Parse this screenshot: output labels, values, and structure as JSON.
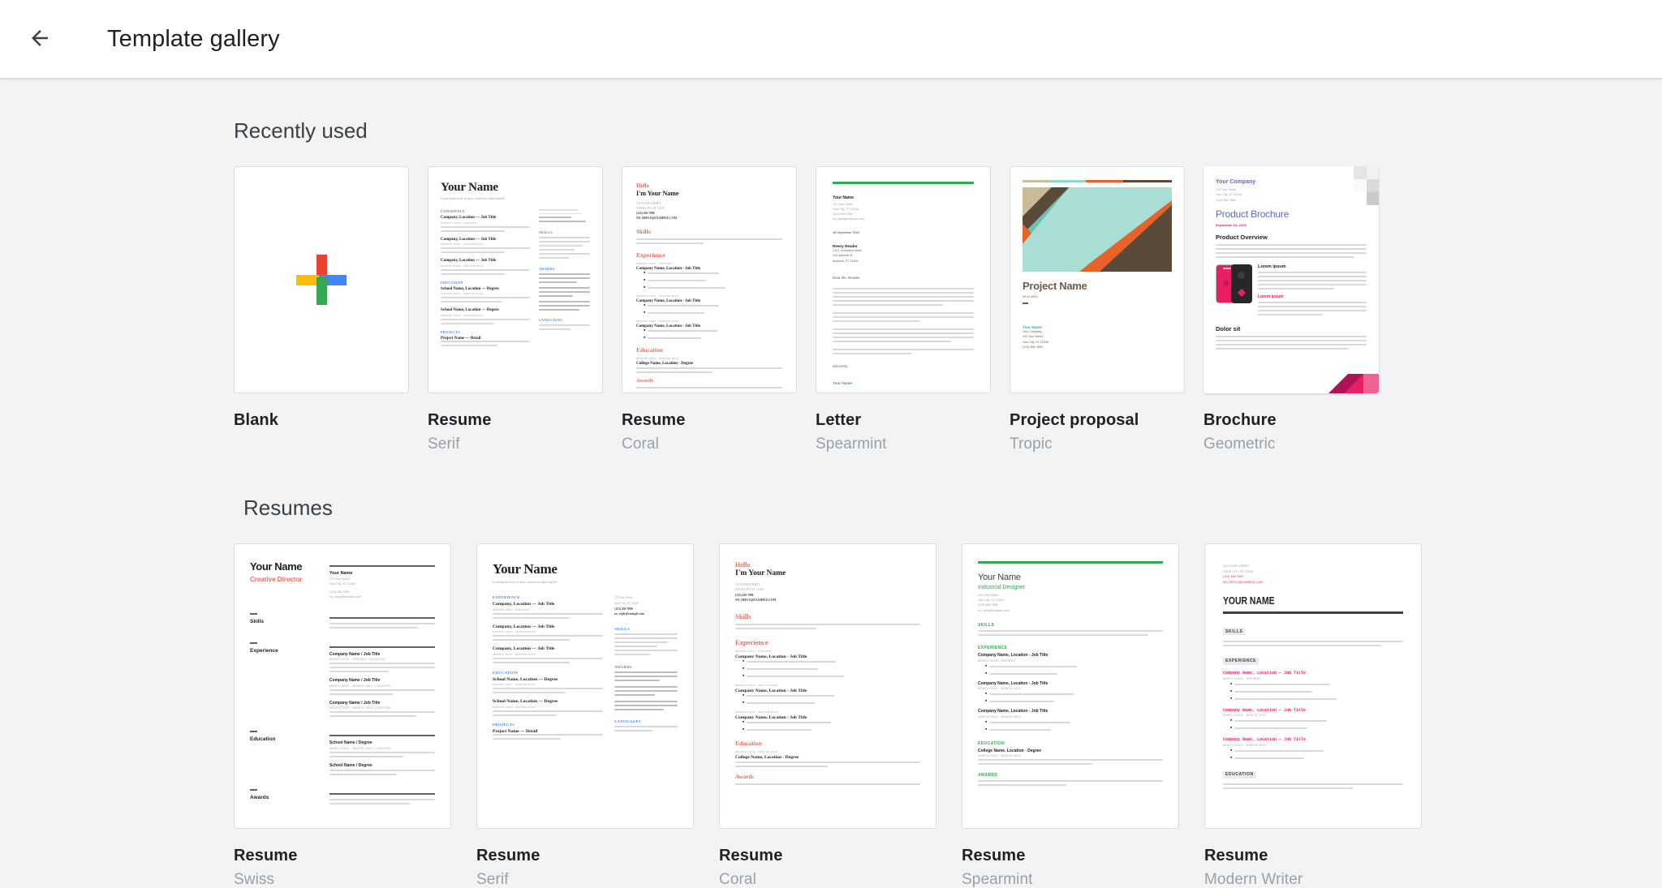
{
  "header": {
    "back_icon": "arrow-left-icon",
    "title": "Template gallery"
  },
  "sections": [
    {
      "id": "recently-used",
      "title": "Recently used",
      "templates": [
        {
          "name": "Blank",
          "sub": ""
        },
        {
          "name": "Resume",
          "sub": "Serif"
        },
        {
          "name": "Resume",
          "sub": "Coral"
        },
        {
          "name": "Letter",
          "sub": "Spearmint"
        },
        {
          "name": "Project proposal",
          "sub": "Tropic"
        },
        {
          "name": "Brochure",
          "sub": "Geometric"
        }
      ]
    },
    {
      "id": "resumes",
      "title": "Resumes",
      "templates": [
        {
          "name": "Resume",
          "sub": "Swiss"
        },
        {
          "name": "Resume",
          "sub": "Serif"
        },
        {
          "name": "Resume",
          "sub": "Coral"
        },
        {
          "name": "Resume",
          "sub": "Spearmint"
        },
        {
          "name": "Resume",
          "sub": "Modern Writer"
        }
      ]
    }
  ],
  "thumb_text": {
    "your_name": "Your Name",
    "hello": "Hello",
    "im_your_name": "I'm Your Name",
    "creative_director": "Creative Director",
    "industrial_designer": "Industrial Designer",
    "your_name_caps": "YOUR NAME",
    "your_company": "Your Company",
    "product_brochure": "Product Brochure",
    "product_overview": "Product Overview",
    "project_name": "Project Name",
    "lorem_ipsum": "Lorem ipsum",
    "dolor_sit": "Dolor sit",
    "experience": "EXPERIENCE",
    "education": "EDUCATION",
    "skills": "SKILLS",
    "awards": "AWARDS",
    "projects": "PROJECTS",
    "languages": "LANGUAGES",
    "skills_tc": "Skills",
    "experience_tc": "Experience",
    "education_tc": "Education",
    "awards_tc": "Awards",
    "projects_tc": "Projects",
    "company_entry": "Company, Location — Job Title",
    "company_entry_full": "Company Name, Location  -  Job Title",
    "company_entry_slash": "Company Name / Job Title",
    "company_entry_mono": "Company Name, Location — Job Title",
    "school_entry": "School Name, Location — Degree",
    "college_entry": "College Name, Location - Degree",
    "school_degree": "School Name / Degree",
    "project_entry": "Project Name — Detail",
    "date_present": "MONTH 20XX - PRESENT",
    "date_range": "MONTH 20XX - MONTH 20XX",
    "date_present_loc": "MONTH 20XX - PRESENT, LOCATION",
    "date_range_loc": "MONTH 20XX - MONTH 20XX, LOCATION",
    "address1": "123 Your Street",
    "address2": "Your City, ST 12345",
    "phone": "(123) 456-7890",
    "email": "no_reply@example.com",
    "address1_caps": "123 YOUR STREET",
    "address2_caps": "YOUR CITY, ST 12345",
    "phone_caps": "(123) 456-7890",
    "email_caps": "NO_REPLY@EXAMPLE.COM",
    "letter_date": "4th September 20XX",
    "recipient_name": "Reeny Reader",
    "recipient_role": "CEO, Company Name",
    "recipient_addr1": "123 Address St",
    "recipient_addr2": "Anytown, ST 12345",
    "salutation": "Dear Ms. Reader,",
    "sincerely": "Sincerely,",
    "proposal_date": "09.04.20XX",
    "brochure_date": "September 04, 20XX",
    "your_company_line": "Your Company",
    "tagline": "Lorem ipsum dolor sit amet, consectetur adipiscing elit.",
    "body": "Lorem ipsum dolor sit amet, consectetur adipiscing elit, sed diam nonummy nibh euismod tincidunt ut laoreet dolore magna aliquam erat volutpat.",
    "bullet1": "Lorem ipsum dolor sit amet, consectetur adipiscing elit.",
    "bullet2": "Aenean ac interdum nisi. Sed in consequat mi.",
    "bullet3": "Sed in consequat mi, sed pulvinar lacinia felis eu finibus."
  },
  "colors": {
    "page_bg": "#f1f3f4",
    "header_bg": "#ffffff",
    "title_text": "#202124",
    "sub_text": "#9aa0a6",
    "google_red": "#ea4335",
    "google_blue": "#4285f4",
    "google_yellow": "#fbbc04",
    "google_green": "#34a853",
    "coral": "#f4695c",
    "spearmint": "#34a853",
    "tropic_brown": "#6d5b49",
    "tropic_mint": "#a8ded4",
    "tropic_orange": "#e8622a",
    "geometric_indigo": "#5c6bc0",
    "geometric_pink": "#e91e63"
  }
}
